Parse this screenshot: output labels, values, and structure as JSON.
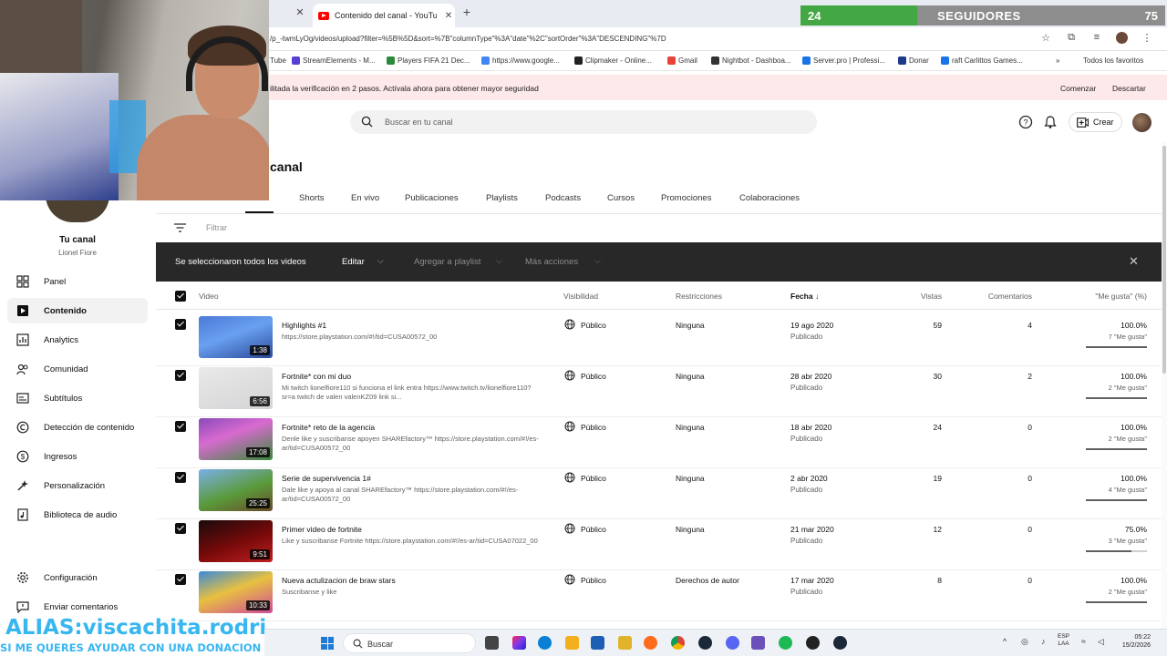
{
  "browser": {
    "active_tab_title": "Contenido del canal - YouTube",
    "url": "/p_-twmLyOg/videos/upload?filter=%5B%5D&sort=%7B\"columnType\"%3A\"date\"%2C\"sortOrder\"%3A\"DESCENDING\"%7D",
    "bookmarks": [
      "Tube",
      "StreamElements - M...",
      "Players FIFA 21 Dec...",
      "https://www.google...",
      "Clipmaker - Online...",
      "Gmail",
      "Nightbot - Dashboa...",
      "Server.pro | Professi...",
      "Donar",
      "raft Carlittos Games...",
      "Todos los favoritos"
    ]
  },
  "followers_overlay": {
    "count": "24",
    "label": "SEGUIDORES",
    "goal": "75",
    "progress": 0.32
  },
  "banner": {
    "text": "ilitada la verificación en 2 pasos. Actívala ahora para obtener mayor seguridad",
    "start_label": "Comenzar",
    "dismiss_label": "Descartar"
  },
  "header": {
    "search_placeholder": "Buscar en tu canal",
    "create_label": "Crear"
  },
  "page": {
    "title": "canal",
    "tab_partial": "s",
    "tabs": [
      "Shorts",
      "En vivo",
      "Publicaciones",
      "Playlists",
      "Podcasts",
      "Cursos",
      "Promociones",
      "Colaboraciones"
    ],
    "filter_placeholder": "Filtrar"
  },
  "selection_bar": {
    "selected_text": "Se seleccionaron todos los videos",
    "edit_label": "Editar",
    "add_playlist_label": "Agregar a playlist",
    "more_actions_label": "Más acciones"
  },
  "table": {
    "headers": {
      "video": "Video",
      "visibility": "Visibilidad",
      "restrictions": "Restricciones",
      "date": "Fecha",
      "views": "Vistas",
      "comments": "Comentarios",
      "likes": "\"Me gusta\" (%)"
    },
    "rows": [
      {
        "duration": "1:38",
        "title": "Highlights #1",
        "desc": "https://store.playstation.com/#!/tid=CUSA00572_00",
        "visibility": "Público",
        "restrictions": "Ninguna",
        "date": "19 ago 2020",
        "status": "Publicado",
        "views": "59",
        "comments": "4",
        "likes_pct": "100.0%",
        "likes_count": "7 \"Me gusta\"",
        "like_ratio": 1.0
      },
      {
        "duration": "6:56",
        "title": "Fortnite* con mi duo",
        "desc": "Mi twitch lionelfiore110 si funciona el link entra https://www.twitch.tv/lionelfiore110?sr=a twitch de valen valenKZ09 link si...",
        "visibility": "Público",
        "restrictions": "Ninguna",
        "date": "28 abr 2020",
        "status": "Publicado",
        "views": "30",
        "comments": "2",
        "likes_pct": "100.0%",
        "likes_count": "2 \"Me gusta\"",
        "like_ratio": 1.0
      },
      {
        "duration": "17:08",
        "title": "Fortnite* reto de la agencia",
        "desc": "Denle like y suscribanse apoyen SHAREfactory™ https://store.playstation.com/#!/es-ar/tid=CUSA00572_00",
        "visibility": "Público",
        "restrictions": "Ninguna",
        "date": "18 abr 2020",
        "status": "Publicado",
        "views": "24",
        "comments": "0",
        "likes_pct": "100.0%",
        "likes_count": "2 \"Me gusta\"",
        "like_ratio": 1.0
      },
      {
        "duration": "25:25",
        "title": "Serie de supervivencia 1#",
        "desc": "Dale like y apoya al canal SHAREfactory™ https://store.playstation.com/#!/es-ar/tid=CUSA00572_00",
        "visibility": "Público",
        "restrictions": "Ninguna",
        "date": "2 abr 2020",
        "status": "Publicado",
        "views": "19",
        "comments": "0",
        "likes_pct": "100.0%",
        "likes_count": "4 \"Me gusta\"",
        "like_ratio": 1.0
      },
      {
        "duration": "9:51",
        "title": "Primer video de fortnite",
        "desc": "Like y suscribanse Fortnite https://store.playstation.com/#!/es-ar/tid=CUSA07022_00",
        "visibility": "Público",
        "restrictions": "Ninguna",
        "date": "21 mar 2020",
        "status": "Publicado",
        "views": "12",
        "comments": "0",
        "likes_pct": "75.0%",
        "likes_count": "3 \"Me gusta\"",
        "like_ratio": 0.75
      },
      {
        "duration": "10:33",
        "title": "Nueva actulizacion de braw stars",
        "desc": "Suscribanse y like",
        "visibility": "Público",
        "restrictions": "Derechos de autor",
        "date": "17 mar 2020",
        "status": "Publicado",
        "views": "8",
        "comments": "0",
        "likes_pct": "100.0%",
        "likes_count": "2 \"Me gusta\"",
        "like_ratio": 1.0
      }
    ]
  },
  "sidebar": {
    "channel_name": "Tu canal",
    "channel_owner": "Lionel Fiore",
    "items": [
      {
        "label": "Panel",
        "icon": "dashboard-icon"
      },
      {
        "label": "Contenido",
        "icon": "content-icon"
      },
      {
        "label": "Analytics",
        "icon": "analytics-icon"
      },
      {
        "label": "Comunidad",
        "icon": "community-icon"
      },
      {
        "label": "Subtítulos",
        "icon": "subtitles-icon"
      },
      {
        "label": "Detección de contenido",
        "icon": "copyright-icon"
      },
      {
        "label": "Ingresos",
        "icon": "earn-icon"
      },
      {
        "label": "Personalización",
        "icon": "customization-icon"
      },
      {
        "label": "Biblioteca de audio",
        "icon": "audio-library-icon"
      }
    ],
    "footer": [
      {
        "label": "Configuración",
        "icon": "settings-icon"
      },
      {
        "label": "Enviar comentarios",
        "icon": "feedback-icon"
      }
    ]
  },
  "stream_overlay": {
    "alias": "ALIAS:viscachita.rodri",
    "donation_text": "SI ME QUERES AYUDAR CON UNA DONACION"
  },
  "taskbar": {
    "search_label": "Buscar",
    "lang_top": "ESP",
    "lang_bottom": "LAA",
    "time": "05:22",
    "date": "15/2/2026"
  },
  "colors": {
    "followers_fill": "#43a743",
    "alias_text": "#38b6f0",
    "selection_bar": "#282828",
    "banner_bg": "#fde8ea"
  }
}
